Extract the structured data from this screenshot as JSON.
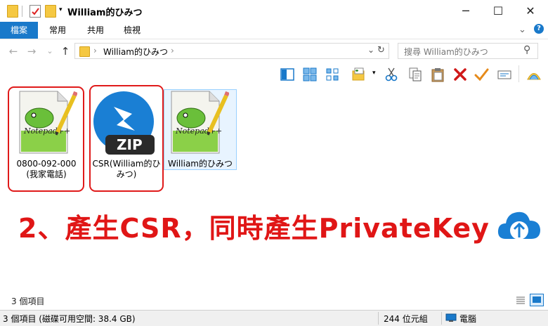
{
  "window": {
    "title": "William的ひみつ",
    "min_glyph": "─",
    "max_glyph": "☐",
    "close_glyph": "✕",
    "help_glyph": "?",
    "collapse_glyph": "⌄"
  },
  "ribbon": {
    "tabs": [
      {
        "label": "檔案"
      },
      {
        "label": "常用"
      },
      {
        "label": "共用"
      },
      {
        "label": "檢視"
      }
    ]
  },
  "address": {
    "back_glyph": "←",
    "forward_glyph": "→",
    "recent_glyph": "⌄",
    "up_glyph": "↑",
    "path_label": "William的ひみつ",
    "chevron": "›",
    "dropdown_glyph": "⌄",
    "refresh_glyph": "↻",
    "search_placeholder": "搜尋 William的ひみつ",
    "search_glyph": "⚲"
  },
  "files": [
    {
      "icon": "notepadpp-file-icon",
      "label": "0800-092-000 (我家電話)",
      "highlighted": true
    },
    {
      "icon": "zip-file-icon",
      "label": "CSR(William的ひみつ)",
      "badge": "ZIP",
      "highlighted": true
    },
    {
      "icon": "notepadpp-file-icon",
      "label": "William的ひみつ",
      "highlighted": false,
      "selected": true
    }
  ],
  "banner": {
    "text": "2、產生CSR，同時產生PrivateKey",
    "color": "#e01616"
  },
  "status": {
    "item_count": "3 個項目",
    "bar_left": "3 個項目 (磁碟可用空間: 38.4 GB)",
    "bar_size": "244 位元組",
    "bar_location": "電腦"
  },
  "colors": {
    "accent": "#1979ca",
    "highlight_box": "#e01a1a",
    "selection_border": "#99d1ff",
    "zip_blue": "#1a7fd4"
  }
}
